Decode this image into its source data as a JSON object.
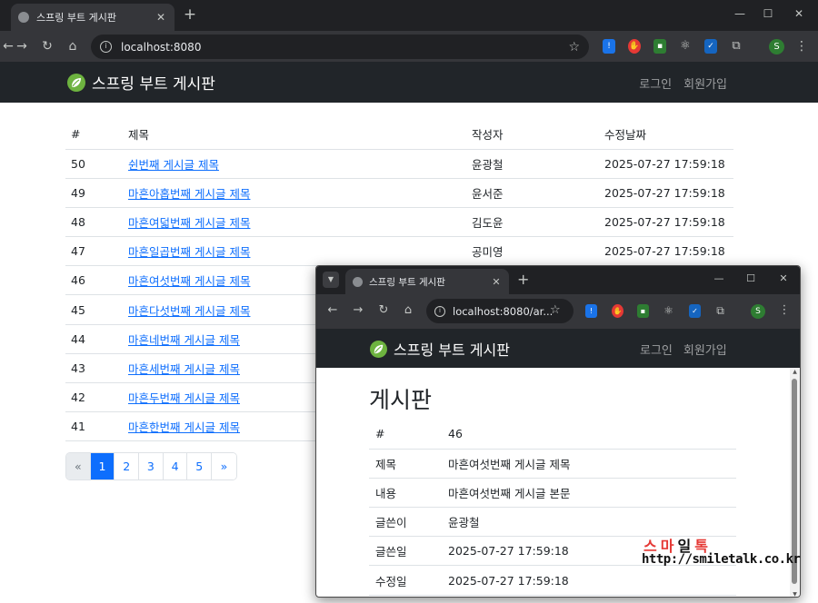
{
  "browser": {
    "tab_title": "스프링 부트 게시판",
    "tab_close": "✕",
    "new_tab": "+",
    "url": "localhost:8080",
    "window_controls": {
      "minimize": "—",
      "maximize": "☐",
      "close": "✕"
    },
    "icons": [
      "back-icon",
      "forward-icon",
      "reload-icon",
      "home-icon",
      "site-info-icon",
      "bookmark-star-icon",
      "extensions-icon",
      "menu-icon"
    ],
    "profile_initial": "S"
  },
  "site": {
    "brand": "스프링 부트 게시판",
    "nav": {
      "login": "로그인",
      "signup": "회원가입"
    }
  },
  "board": {
    "headers": {
      "num": "#",
      "title": "제목",
      "author": "작성자",
      "modified": "수정날짜"
    },
    "rows": [
      {
        "num": "50",
        "title": "쉰번째 게시글 제목",
        "author": "윤광철",
        "modified": "2025-07-27 17:59:18"
      },
      {
        "num": "49",
        "title": "마흔아홉번째 게시글 제목",
        "author": "윤서준",
        "modified": "2025-07-27 17:59:18"
      },
      {
        "num": "48",
        "title": "마흔여덟번째 게시글 제목",
        "author": "김도윤",
        "modified": "2025-07-27 17:59:18"
      },
      {
        "num": "47",
        "title": "마흔일곱번째 게시글 제목",
        "author": "공미영",
        "modified": "2025-07-27 17:59:18"
      },
      {
        "num": "46",
        "title": "마흔여섯번째 게시글 제목",
        "author": "",
        "modified": ""
      },
      {
        "num": "45",
        "title": "마흔다섯번째 게시글 제목",
        "author": "",
        "modified": ""
      },
      {
        "num": "44",
        "title": "마흔네번째 게시글 제목",
        "author": "",
        "modified": ""
      },
      {
        "num": "43",
        "title": "마흔세번째 게시글 제목",
        "author": "",
        "modified": ""
      },
      {
        "num": "42",
        "title": "마흔두번째 게시글 제목",
        "author": "",
        "modified": ""
      },
      {
        "num": "41",
        "title": "마흔한번째 게시글 제목",
        "author": "",
        "modified": ""
      }
    ],
    "pagination": {
      "prev": "«",
      "pages": [
        "1",
        "2",
        "3",
        "4",
        "5"
      ],
      "next": "»",
      "active": "1"
    }
  },
  "popup": {
    "tab_title": "스프링 부트 게시판",
    "url": "localhost:8080/ar...",
    "brand": "스프링 부트 게시판",
    "nav": {
      "login": "로그인",
      "signup": "회원가입"
    },
    "heading": "게시판",
    "detail": [
      {
        "label": "#",
        "value": "46"
      },
      {
        "label": "제목",
        "value": "마흔여섯번째 게시글 제목"
      },
      {
        "label": "내용",
        "value": "마흔여섯번째 게시글 본문"
      },
      {
        "label": "글쓴이",
        "value": "윤광철"
      },
      {
        "label": "글쓴일",
        "value": "2025-07-27 17:59:18"
      },
      {
        "label": "수정일",
        "value": "2025-07-27 17:59:18"
      }
    ]
  },
  "watermark": {
    "korean": [
      "스",
      "마",
      "일",
      "톡"
    ],
    "korean_colors": [
      "#e53935",
      "#e53935",
      "#111111",
      "#e53935"
    ],
    "url": "http://smiletalk.co.kr"
  },
  "colors": {
    "navbar_bg": "#212529",
    "link": "#0d6efd",
    "chrome_dark": "#202124",
    "chrome_toolbar": "#35363a"
  }
}
